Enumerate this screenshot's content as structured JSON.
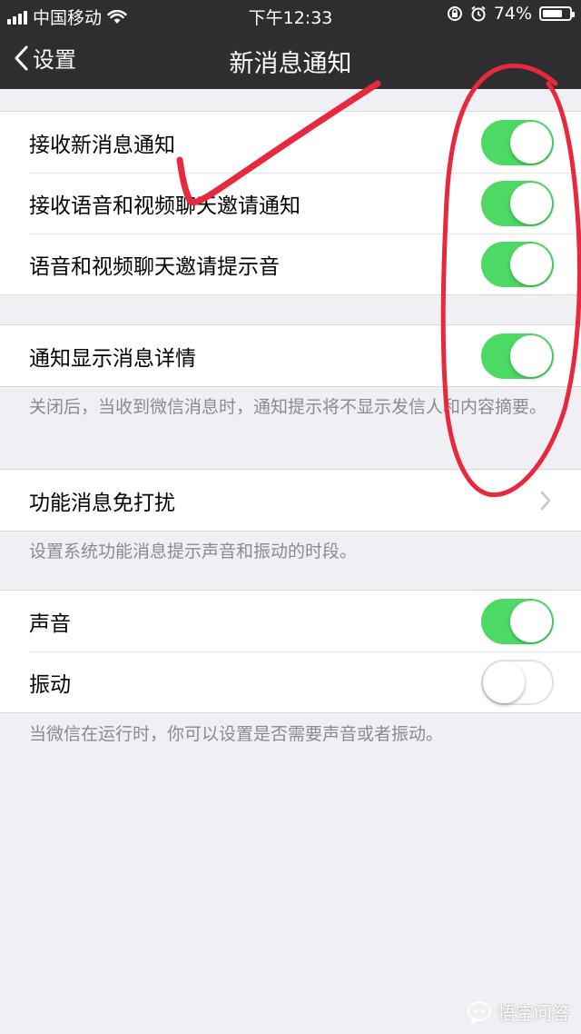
{
  "status_bar": {
    "carrier": "中国移动",
    "time": "下午12:33",
    "battery": "74%",
    "battery_level": 0.74
  },
  "nav": {
    "back_label": "设置",
    "title": "新消息通知"
  },
  "groups": [
    {
      "items": [
        {
          "label": "接收新消息通知",
          "enabled": true
        },
        {
          "label": "接收语音和视频聊天邀请通知",
          "enabled": true
        },
        {
          "label": "语音和视频聊天邀请提示音",
          "enabled": true
        }
      ]
    },
    {
      "items": [
        {
          "label": "通知显示消息详情",
          "enabled": true
        }
      ],
      "footer": "关闭后，当收到微信消息时，通知提示将不显示发信人和内容摘要。"
    },
    {
      "items": [
        {
          "label": "功能消息免打扰"
        }
      ],
      "footer": "设置系统功能消息提示声音和振动的时段。"
    },
    {
      "items": [
        {
          "label": "声音",
          "enabled": true
        },
        {
          "label": "振动",
          "enabled": false
        }
      ],
      "footer": "当微信在运行时，你可以设置是否需要声音或者振动。"
    }
  ],
  "colors": {
    "toggle_on": "#4cd964",
    "annotation": "#e8283c",
    "nav_background": "#2e2e31"
  },
  "watermark": "悟空问答"
}
